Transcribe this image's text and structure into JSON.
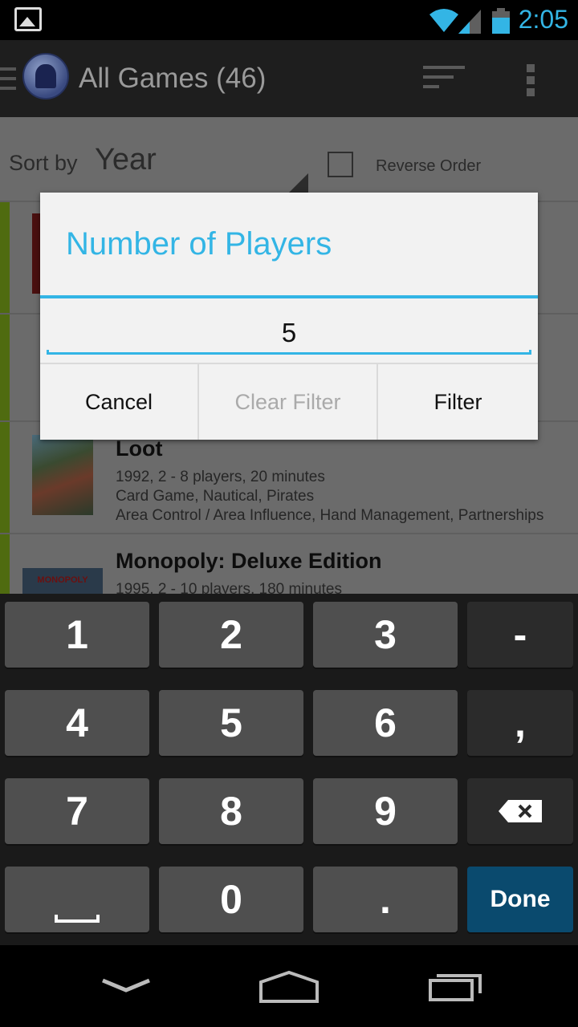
{
  "status_bar": {
    "time": "2:05",
    "icons": [
      "image-notification-icon",
      "wifi-icon",
      "signal-icon",
      "battery-icon"
    ],
    "accent_color": "#33b5e5"
  },
  "action_bar": {
    "title": "All Games (46)",
    "icons": [
      "drawer-icon",
      "app-logo-icon",
      "sort-icon",
      "overflow-menu-icon"
    ]
  },
  "sort_bar": {
    "label": "Sort by",
    "value": "Year",
    "reverse_label": "Reverse Order",
    "reverse_checked": false
  },
  "games": [
    {
      "title": "Loot",
      "line1": "1992, 2 - 8 players, 20 minutes",
      "line2": "Card Game, Nautical, Pirates",
      "line3": "Area Control / Area Influence, Hand Management, Partnerships"
    },
    {
      "title": "Monopoly: Deluxe Edition",
      "line1": "1995, 2 - 10 players, 180 minutes",
      "thumb_text": "MONOPOLY"
    }
  ],
  "dialog": {
    "title": "Number of Players",
    "input_value": "5",
    "buttons": {
      "cancel": "Cancel",
      "clear": "Clear Filter",
      "filter": "Filter"
    }
  },
  "keyboard": {
    "keys": [
      "1",
      "2",
      "3",
      "-",
      "4",
      "5",
      "6",
      ",",
      "7",
      "8",
      "9",
      "0",
      "."
    ],
    "done": "Done",
    "icons": [
      "space-key-icon",
      "backspace-icon"
    ]
  },
  "nav_bar": {
    "icons": [
      "back-icon",
      "home-icon",
      "recents-icon"
    ]
  }
}
